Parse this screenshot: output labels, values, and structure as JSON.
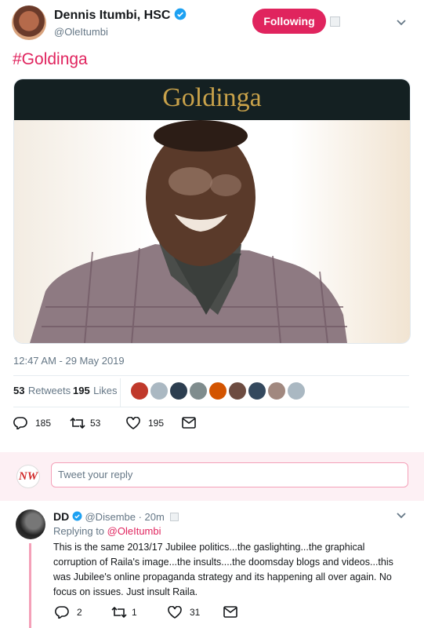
{
  "tweet": {
    "author_name": "Dennis Itumbi, HSC",
    "author_handle": "@OleItumbi",
    "follow_label": "Following",
    "hashtag": "#Goldinga",
    "image_banner_text": "Goldinga",
    "timestamp": "12:47 AM - 29 May 2019",
    "retweets_count": "53",
    "retweets_label": "Retweets",
    "likes_count": "195",
    "likes_label": "Likes",
    "replies_action": "185",
    "retweets_action": "53",
    "likes_action": "195"
  },
  "composer": {
    "placeholder": "Tweet your reply",
    "avatar_text": "NW"
  },
  "reply": {
    "author_name": "DD",
    "author_handle": "@Disembe",
    "time": "· 20m",
    "replying_prefix": "Replying to",
    "replying_to": "@OleItumbi",
    "text": "This is the same 2013/17 Jubilee politics...the gaslighting...the graphical corruption of Raila's image...the insults....the doomsday blogs and videos...this was Jubilee's online propaganda strategy and its happening all over again. No focus on issues. Just insult Raila.",
    "replies": "2",
    "retweets": "1",
    "likes": "31"
  },
  "colors": {
    "accent": "#e0245e",
    "verified": "#1da1f2",
    "banner_bg": "#142022",
    "banner_text": "#c9a24a"
  }
}
